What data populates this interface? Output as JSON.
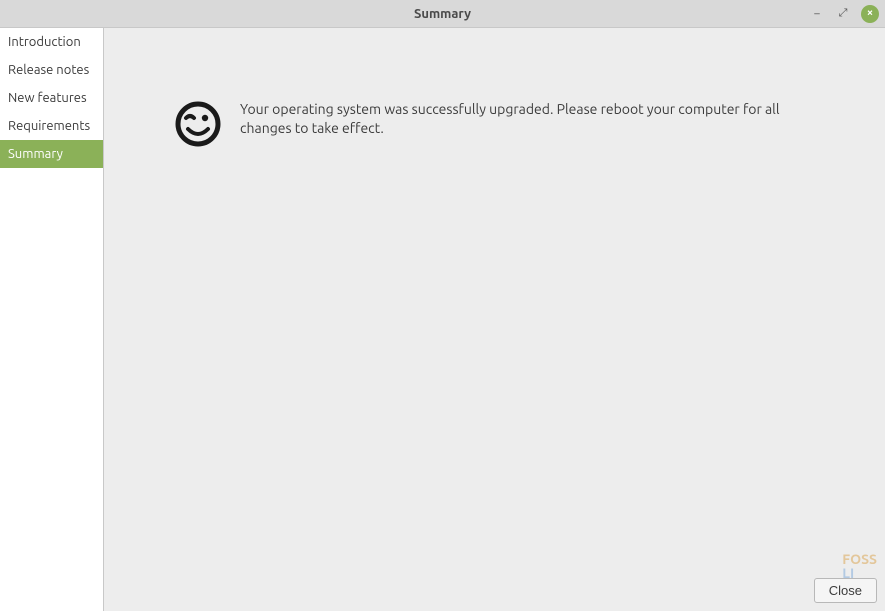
{
  "titlebar": {
    "title": "Summary",
    "minimize_label": "–",
    "maximize_label": "⤢",
    "close_label": "×"
  },
  "sidebar": {
    "items": [
      {
        "label": "Introduction",
        "active": false
      },
      {
        "label": "Release notes",
        "active": false
      },
      {
        "label": "New features",
        "active": false
      },
      {
        "label": "Requirements",
        "active": false
      },
      {
        "label": "Summary",
        "active": true
      }
    ]
  },
  "main": {
    "icon": "smiley-wink",
    "message": "Your operating system was successfully upgraded. Please reboot your computer for all changes to take effect."
  },
  "footer": {
    "close_label": "Close"
  },
  "watermark": {
    "line1": "FOSS",
    "line2": "LI"
  }
}
